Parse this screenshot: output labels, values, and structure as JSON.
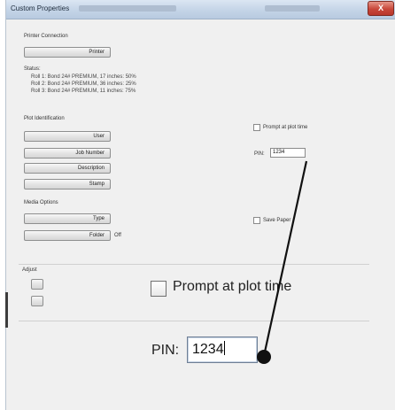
{
  "window": {
    "title": "Custom Properties",
    "close_glyph": "X"
  },
  "printer_connection": {
    "caption": "Printer Connection",
    "printer_button": "Printer"
  },
  "status": {
    "caption": "Status:",
    "lines": [
      "Roll 1: Bond 24# PREMIUM, 17 inches: 50%",
      "Roll 2: Bond 24# PREMIUM, 36 inches: 25%",
      "Roll 3: Bond 24# PREMIUM, 11 inches: 75%"
    ]
  },
  "plot_identification": {
    "caption": "Plot Identification",
    "buttons": [
      "User",
      "Job Number",
      "Description",
      "Stamp"
    ],
    "prompt_label": "Prompt at plot time",
    "prompt_checked": false,
    "pin_label": "PIN:",
    "pin_value": "1234"
  },
  "media_options": {
    "caption": "Media Options",
    "type_button": "Type",
    "folder_button": "Folder",
    "folder_value": "Off",
    "save_paper_label": "Save Paper",
    "save_paper_checked": false
  },
  "adjust": {
    "caption": "Adjust"
  },
  "zoom": {
    "prompt_label": "Prompt at plot time",
    "pin_label": "PIN:",
    "pin_value": "1234"
  },
  "colors": {
    "pointer": "#111111",
    "close": "#c8473a"
  },
  "icons": {
    "close": "close-icon",
    "pointer": "callout-pointer-icon"
  }
}
